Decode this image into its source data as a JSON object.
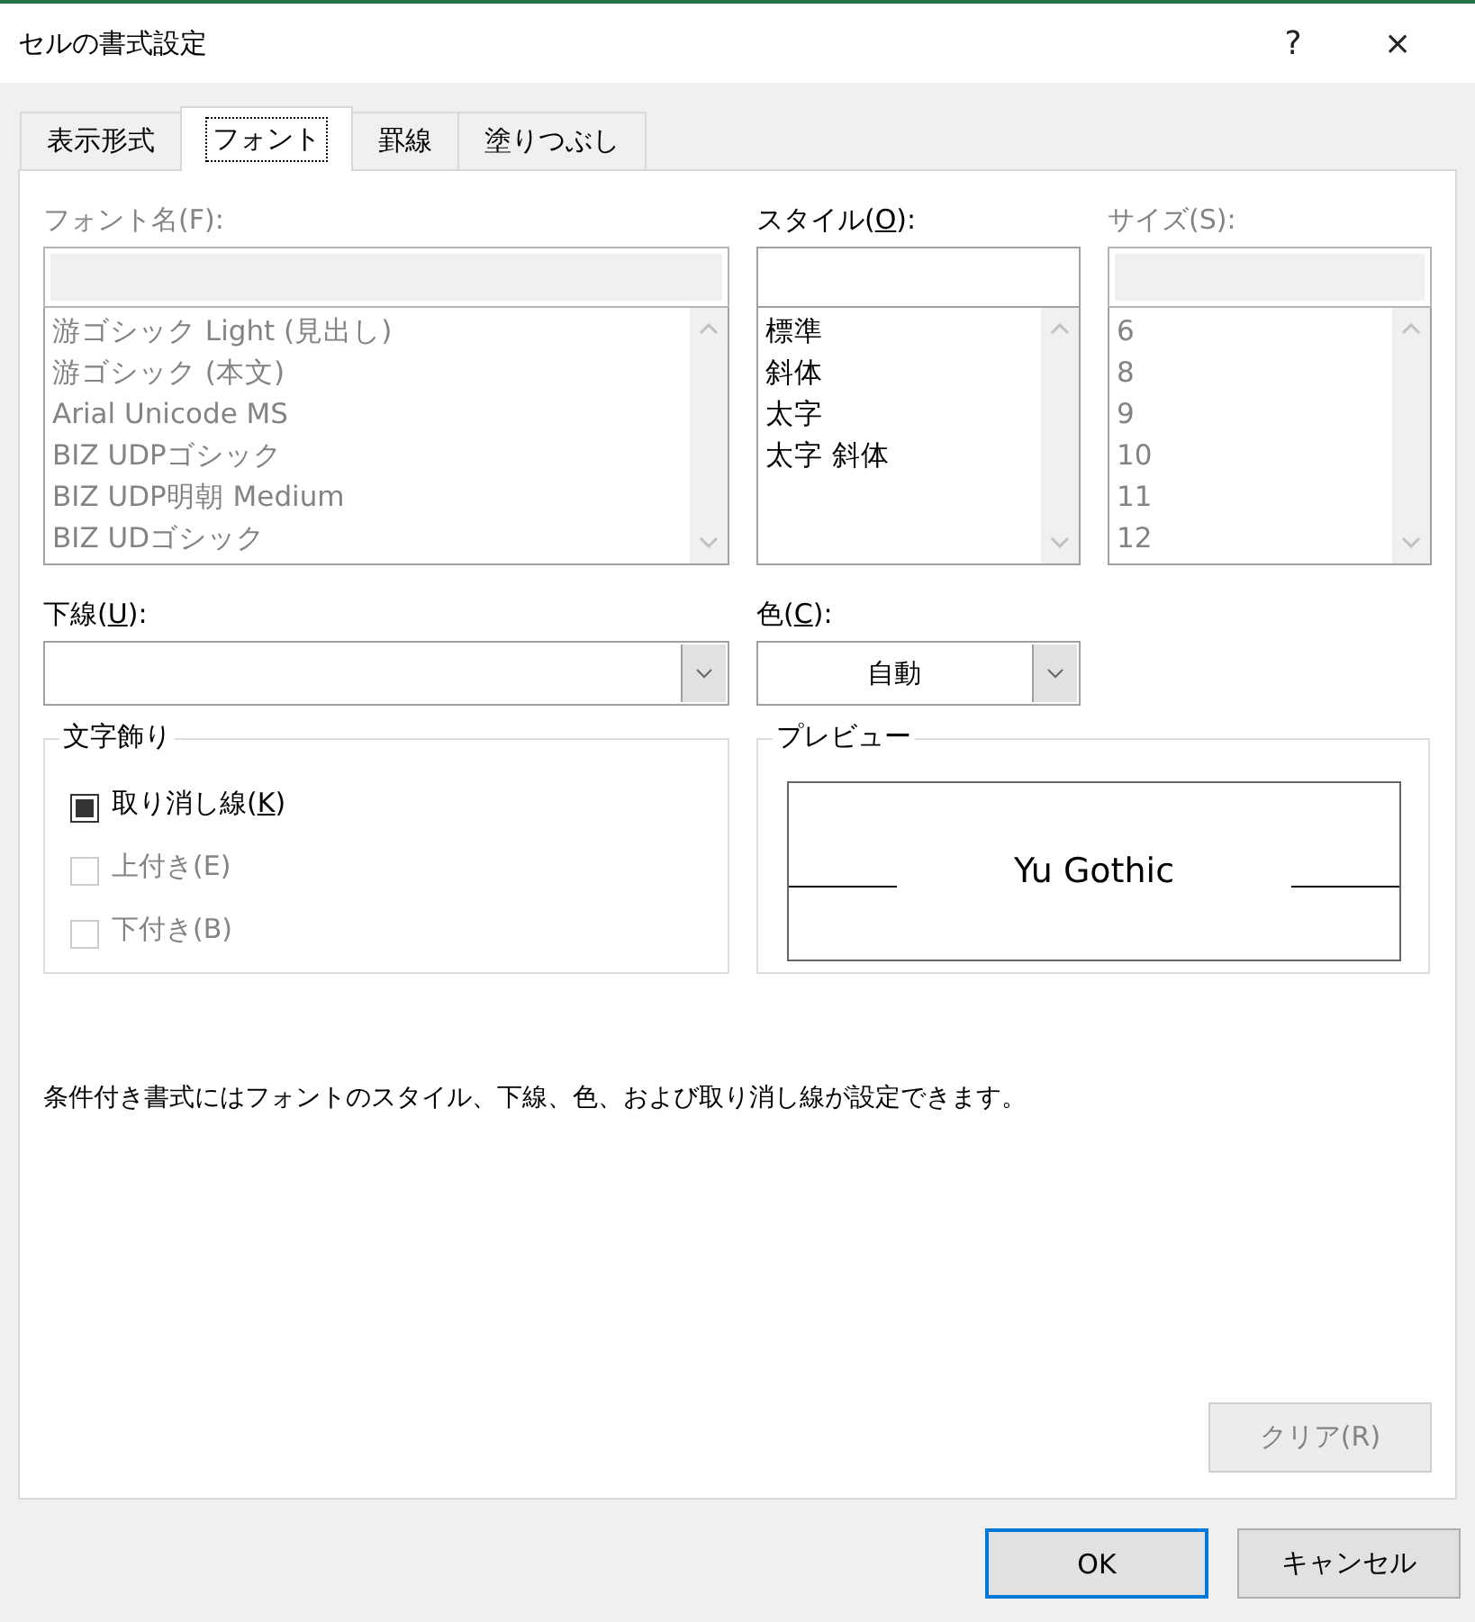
{
  "window": {
    "title": "セルの書式設定",
    "help": "?",
    "close": "×"
  },
  "tabs": [
    {
      "label": "表示形式",
      "selected": false
    },
    {
      "label": "フォント",
      "selected": true
    },
    {
      "label": "罫線",
      "selected": false
    },
    {
      "label": "塗りつぶし",
      "selected": false
    }
  ],
  "lists": [
    {
      "label_before": "フォント名(F):",
      "disabled": true,
      "items": [
        "游ゴシック Light (見出し)",
        "游ゴシック (本文)",
        "Arial Unicode MS",
        "BIZ UDPゴシック",
        "BIZ UDP明朝 Medium",
        "BIZ UDゴシック"
      ]
    },
    {
      "label_before": "スタイル(",
      "access_key": "O",
      "label_after": "):",
      "disabled": false,
      "items": [
        "標準",
        "斜体",
        "太字",
        "太字 斜体"
      ]
    },
    {
      "label_before": "サイズ(S):",
      "disabled": true,
      "items": [
        "6",
        "8",
        "9",
        "10",
        "11",
        "12"
      ]
    }
  ],
  "underline": {
    "label_before": "下線(",
    "access_key": "U",
    "label_after": "):"
  },
  "color": {
    "label_before": "色(",
    "access_key": "C",
    "label_after": "):",
    "value": "自動"
  },
  "effects": {
    "title": "文字飾り",
    "options": [
      {
        "label_before": "取り消し線(",
        "access_key": "K",
        "label_after": ")",
        "checked": true,
        "disabled": false
      },
      {
        "label_before": "上付き(E)",
        "checked": false,
        "disabled": true
      },
      {
        "label_before": "下付き(B)",
        "checked": false,
        "disabled": true
      }
    ]
  },
  "preview": {
    "title": "プレビュー",
    "sample": "Yu Gothic"
  },
  "note": "条件付き書式にはフォントのスタイル、下線、色、および取り消し線が設定できます。",
  "clear_button": {
    "label": "クリア(R)",
    "disabled": true
  },
  "buttons": [
    {
      "label": "OK",
      "default": true
    },
    {
      "label": "キャンセル",
      "default": false
    }
  ]
}
